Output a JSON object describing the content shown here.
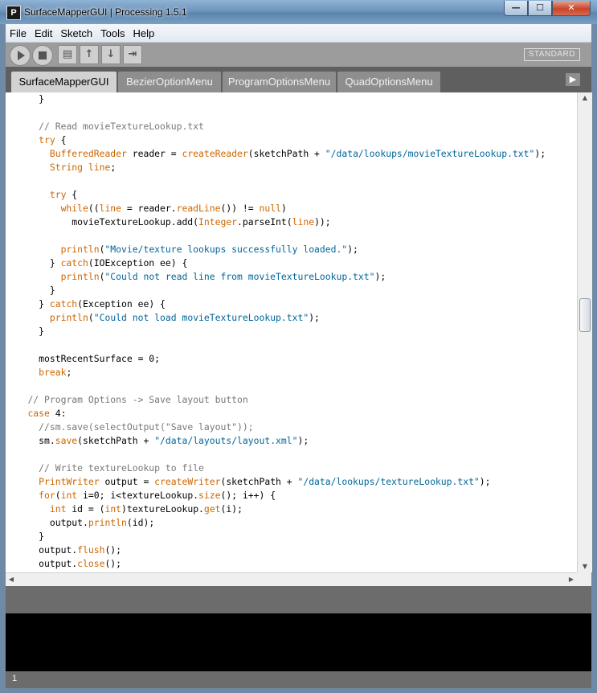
{
  "window": {
    "title": "SurfaceMapperGUI | Processing 1.5.1",
    "app_icon": "P",
    "min": "—",
    "max": "☐",
    "close": "✕"
  },
  "menu": [
    "File",
    "Edit",
    "Sketch",
    "Tools",
    "Help"
  ],
  "toolbar": {
    "mode": "STANDARD",
    "icons": [
      "run-icon",
      "stop-icon",
      "new-icon",
      "open-icon",
      "save-icon",
      "export-icon"
    ]
  },
  "tabs": [
    "SurfaceMapperGUI",
    "BezierOptionMenu",
    "ProgramOptionsMenu",
    "QuadOptionsMenu"
  ],
  "active_tab": "SurfaceMapperGUI",
  "code_lines": [
    [
      [
        "      }",
        ""
      ]
    ],
    [
      [
        "",
        ""
      ]
    ],
    [
      [
        "      ",
        ""
      ],
      [
        "// Read movieTextureLookup.txt",
        "cm"
      ]
    ],
    [
      [
        "      ",
        ""
      ],
      [
        "try",
        "kw"
      ],
      [
        " {",
        ""
      ]
    ],
    [
      [
        "        ",
        ""
      ],
      [
        "BufferedReader",
        "ty"
      ],
      [
        " reader = ",
        ""
      ],
      [
        "createReader",
        "kw"
      ],
      [
        "(sketchPath + ",
        ""
      ],
      [
        "\"/data/lookups/movieTextureLookup.txt\"",
        "st"
      ],
      [
        ");",
        ""
      ]
    ],
    [
      [
        "        ",
        ""
      ],
      [
        "String",
        "ty"
      ],
      [
        " ",
        ""
      ],
      [
        "line",
        "kw"
      ],
      [
        ";",
        ""
      ]
    ],
    [
      [
        "",
        ""
      ]
    ],
    [
      [
        "        ",
        ""
      ],
      [
        "try",
        "kw"
      ],
      [
        " {",
        ""
      ]
    ],
    [
      [
        "          ",
        ""
      ],
      [
        "while",
        "kw"
      ],
      [
        "((",
        ""
      ],
      [
        "line",
        "kw"
      ],
      [
        " = reader.",
        ""
      ],
      [
        "readLine",
        "kw"
      ],
      [
        "()) != ",
        ""
      ],
      [
        "null",
        "kw"
      ],
      [
        ")",
        ""
      ]
    ],
    [
      [
        "            movieTextureLookup.add(",
        ""
      ],
      [
        "Integer",
        "ty"
      ],
      [
        ".parseInt(",
        ""
      ],
      [
        "line",
        "kw"
      ],
      [
        "));",
        ""
      ]
    ],
    [
      [
        "",
        ""
      ]
    ],
    [
      [
        "          ",
        ""
      ],
      [
        "println",
        "kw"
      ],
      [
        "(",
        ""
      ],
      [
        "\"Movie/texture lookups successfully loaded.\"",
        "st"
      ],
      [
        ");",
        ""
      ]
    ],
    [
      [
        "        } ",
        ""
      ],
      [
        "catch",
        "kw"
      ],
      [
        "(IOException ee) {",
        ""
      ]
    ],
    [
      [
        "          ",
        ""
      ],
      [
        "println",
        "kw"
      ],
      [
        "(",
        ""
      ],
      [
        "\"Could not read line from movieTextureLookup.txt\"",
        "st"
      ],
      [
        ");",
        ""
      ]
    ],
    [
      [
        "        }",
        ""
      ]
    ],
    [
      [
        "      } ",
        ""
      ],
      [
        "catch",
        "kw"
      ],
      [
        "(Exception ee) {",
        ""
      ]
    ],
    [
      [
        "        ",
        ""
      ],
      [
        "println",
        "kw"
      ],
      [
        "(",
        ""
      ],
      [
        "\"Could not load movieTextureLookup.txt\"",
        "st"
      ],
      [
        ");",
        ""
      ]
    ],
    [
      [
        "      }",
        ""
      ]
    ],
    [
      [
        "",
        ""
      ]
    ],
    [
      [
        "      mostRecentSurface = 0;",
        ""
      ]
    ],
    [
      [
        "      ",
        ""
      ],
      [
        "break",
        "kw"
      ],
      [
        ";",
        ""
      ]
    ],
    [
      [
        "",
        ""
      ]
    ],
    [
      [
        "    ",
        ""
      ],
      [
        "// Program Options -> Save layout button",
        "cm"
      ]
    ],
    [
      [
        "    ",
        ""
      ],
      [
        "case",
        "kw"
      ],
      [
        " 4:",
        ""
      ]
    ],
    [
      [
        "      ",
        ""
      ],
      [
        "//sm.save(selectOutput(\"Save layout\"));",
        "cm"
      ]
    ],
    [
      [
        "      sm.",
        ""
      ],
      [
        "save",
        "kw"
      ],
      [
        "(sketchPath + ",
        ""
      ],
      [
        "\"/data/layouts/layout.xml\"",
        "st"
      ],
      [
        ");",
        ""
      ]
    ],
    [
      [
        "",
        ""
      ]
    ],
    [
      [
        "      ",
        ""
      ],
      [
        "// Write textureLookup to file",
        "cm"
      ]
    ],
    [
      [
        "      ",
        ""
      ],
      [
        "PrintWriter",
        "ty"
      ],
      [
        " output = ",
        ""
      ],
      [
        "createWriter",
        "kw"
      ],
      [
        "(sketchPath + ",
        ""
      ],
      [
        "\"/data/lookups/textureLookup.txt\"",
        "st"
      ],
      [
        ");",
        ""
      ]
    ],
    [
      [
        "      ",
        ""
      ],
      [
        "for",
        "kw"
      ],
      [
        "(",
        ""
      ],
      [
        "int",
        "ty"
      ],
      [
        " i=0; i<textureLookup.",
        ""
      ],
      [
        "size",
        "kw"
      ],
      [
        "(); i++) {",
        ""
      ]
    ],
    [
      [
        "        ",
        ""
      ],
      [
        "int",
        "ty"
      ],
      [
        " id = (",
        ""
      ],
      [
        "int",
        "ty"
      ],
      [
        ")textureLookup.",
        ""
      ],
      [
        "get",
        "kw"
      ],
      [
        "(i);",
        ""
      ]
    ],
    [
      [
        "        output.",
        ""
      ],
      [
        "println",
        "kw"
      ],
      [
        "(id);",
        ""
      ]
    ],
    [
      [
        "      }",
        ""
      ]
    ],
    [
      [
        "      output.",
        ""
      ],
      [
        "flush",
        "kw"
      ],
      [
        "();",
        ""
      ]
    ],
    [
      [
        "      output.",
        ""
      ],
      [
        "close",
        "kw"
      ],
      [
        "();",
        ""
      ]
    ]
  ],
  "line_number": "1",
  "scroll": {
    "up": "▲",
    "down": "▼",
    "left": "◀",
    "right": "▶"
  },
  "colors": {
    "keyword": "#cc6600",
    "string": "#006699",
    "comment": "#777777"
  }
}
